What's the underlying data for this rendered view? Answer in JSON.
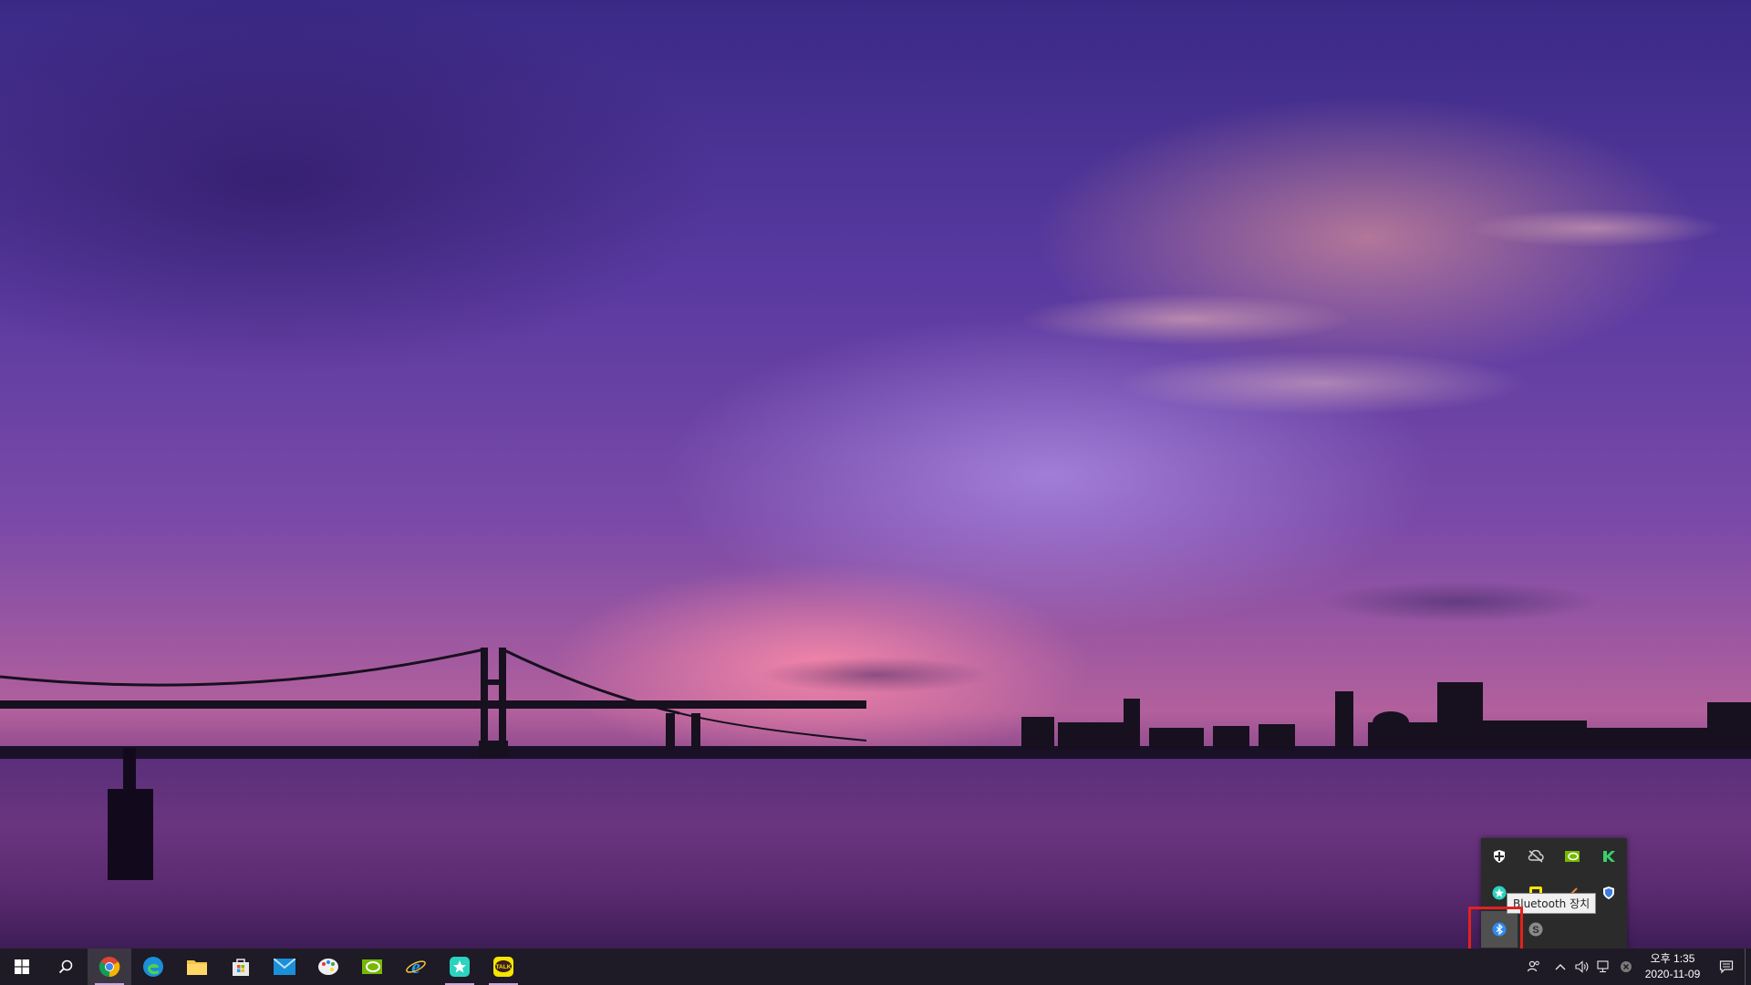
{
  "wallpaper": {
    "description_icon": "sunset-bridge-wallpaper"
  },
  "taskbar": {
    "start": {
      "icon": "windows-logo-icon"
    },
    "search": {
      "icon": "search-icon"
    },
    "apps": [
      {
        "name": "chrome",
        "icon": "chrome-icon",
        "active": true
      },
      {
        "name": "edge",
        "icon": "edge-icon"
      },
      {
        "name": "file-explorer",
        "icon": "folder-icon"
      },
      {
        "name": "microsoft-store",
        "icon": "store-icon"
      },
      {
        "name": "mail",
        "icon": "mail-icon"
      },
      {
        "name": "paint",
        "icon": "palette-icon"
      },
      {
        "name": "nvidia",
        "icon": "nvidia-icon"
      },
      {
        "name": "internet-explorer",
        "icon": "ie-icon"
      },
      {
        "name": "app-star",
        "icon": "star-app-icon",
        "running": true
      },
      {
        "name": "kakaotalk",
        "icon": "kakaotalk-icon",
        "label": "TALK",
        "running": true
      }
    ],
    "tray": {
      "people_icon": "people-icon",
      "chevron_icon": "chevron-up-icon",
      "volume_icon": "speaker-icon",
      "network_icon": "network-icon",
      "error_icon": "x-circle-icon",
      "clock_time": "오후 1:35",
      "clock_date": "2020-11-09",
      "notification_icon": "notification-icon"
    }
  },
  "flyout": {
    "icons": [
      "defender-icon",
      "cloud-off-icon",
      "nvidia-icon",
      "kaspersky-k-icon",
      "star-app-icon",
      "yellow-app-icon",
      "pen-icon",
      "shield-icon",
      "bluetooth-icon",
      "s-app-icon"
    ],
    "tooltip": "Bluetooth 장치",
    "s_label": "S"
  },
  "colors": {
    "taskbar_bg": "#1e1a26",
    "highlight": "#e3211f",
    "bluetooth": "#2f8cf0",
    "kakao_yellow": "#f7e600"
  }
}
